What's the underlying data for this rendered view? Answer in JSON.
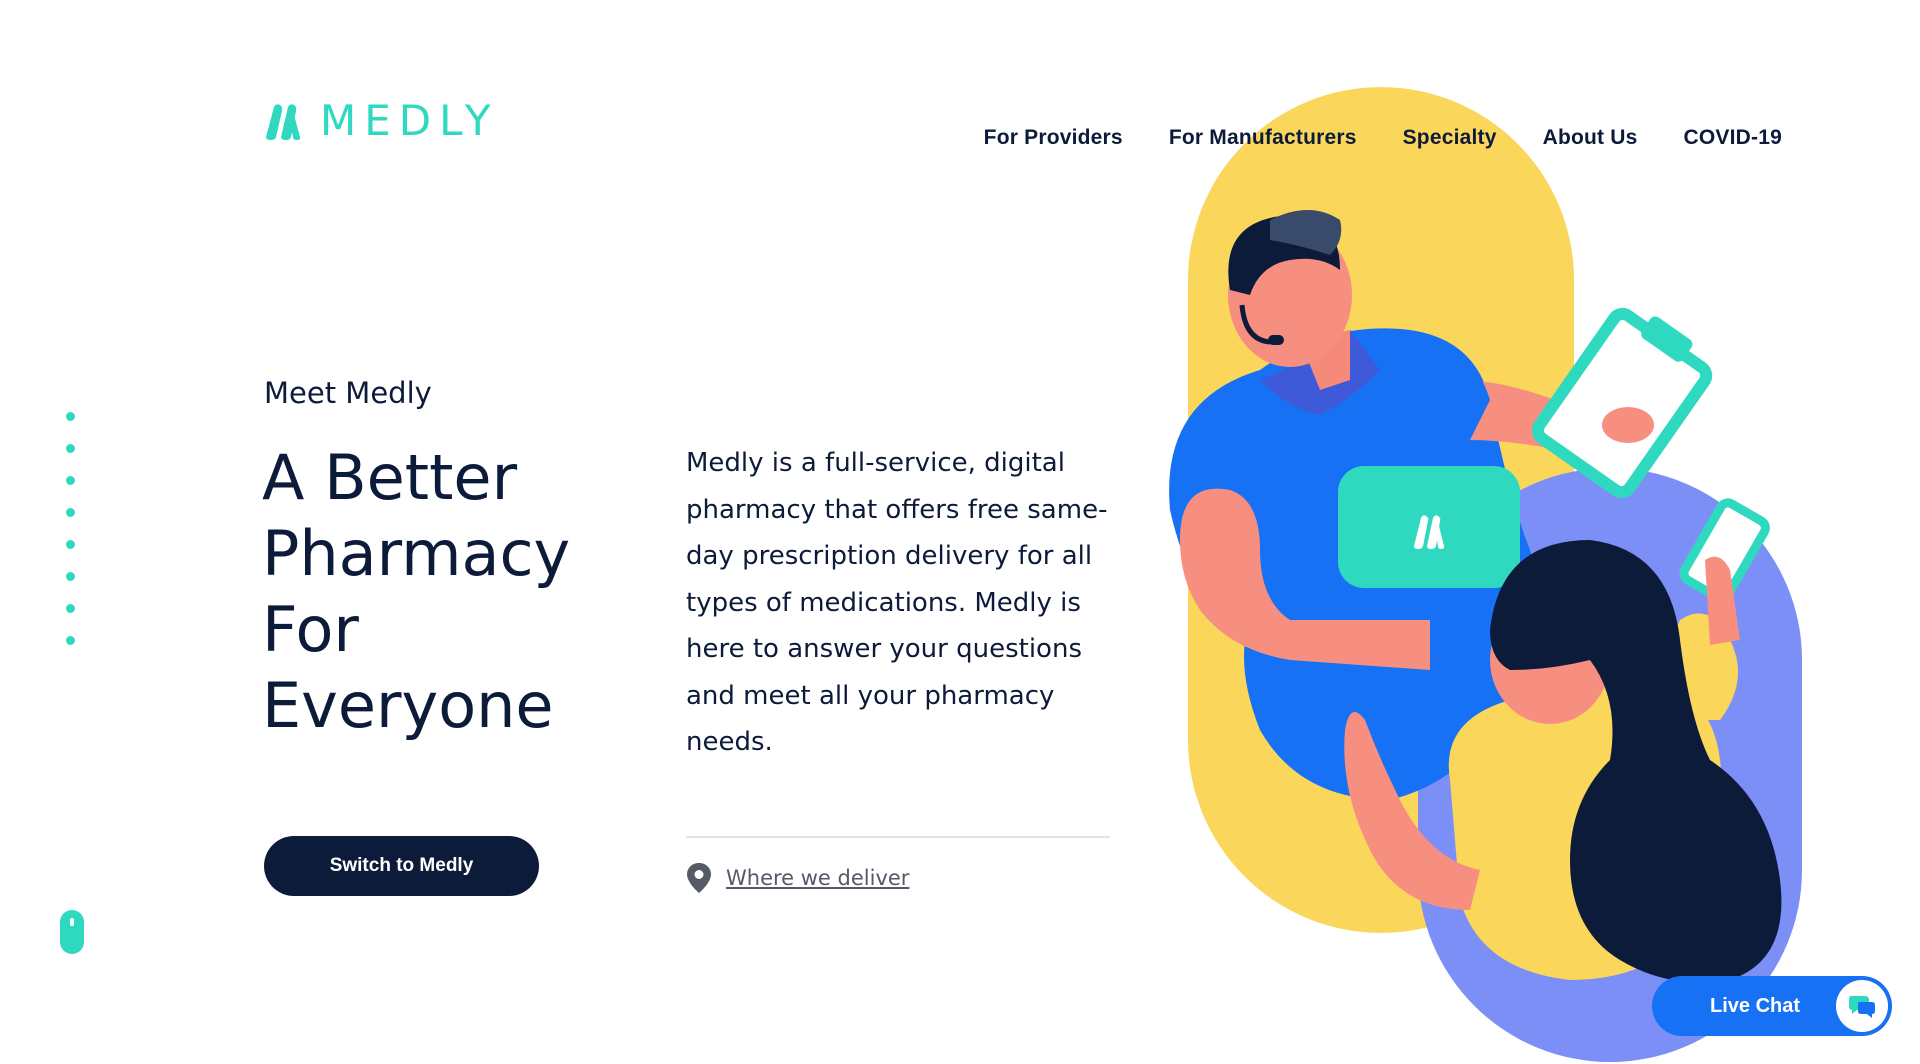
{
  "brand": {
    "name": "MEDLY",
    "color": "#2fd9c0",
    "dark": "#0d1b3a"
  },
  "nav": {
    "items": [
      {
        "label": "For Providers"
      },
      {
        "label": "For Manufacturers"
      },
      {
        "label": "Specialty"
      },
      {
        "label": "About Us"
      },
      {
        "label": "COVID-19"
      }
    ]
  },
  "hero": {
    "eyebrow": "Meet Medly",
    "headline": "A Better Pharmacy For Everyone",
    "cta_label": "Switch to Medly",
    "description": "Medly is a full-service, digital pharmacy that offers free same-day prescription delivery for all types of medications. Medly is here to answer your questions and meet all your pharmacy needs.",
    "delivery_link": "Where we deliver"
  },
  "icons": {
    "logo": "medly-m-logo-icon",
    "location": "location-pin-icon",
    "chat": "chat-bubbles-icon",
    "scroll": "scroll-mouse-icon"
  },
  "live_chat": {
    "label": "Live Chat",
    "color": "#1671f5"
  },
  "illustration_colors": {
    "yellow": "#fad65a",
    "blue": "#1671f5",
    "periwinkle": "#7c8ff7",
    "teal": "#2fd9c0",
    "skin": "#f78f80",
    "hair": "#0d1b3a"
  }
}
